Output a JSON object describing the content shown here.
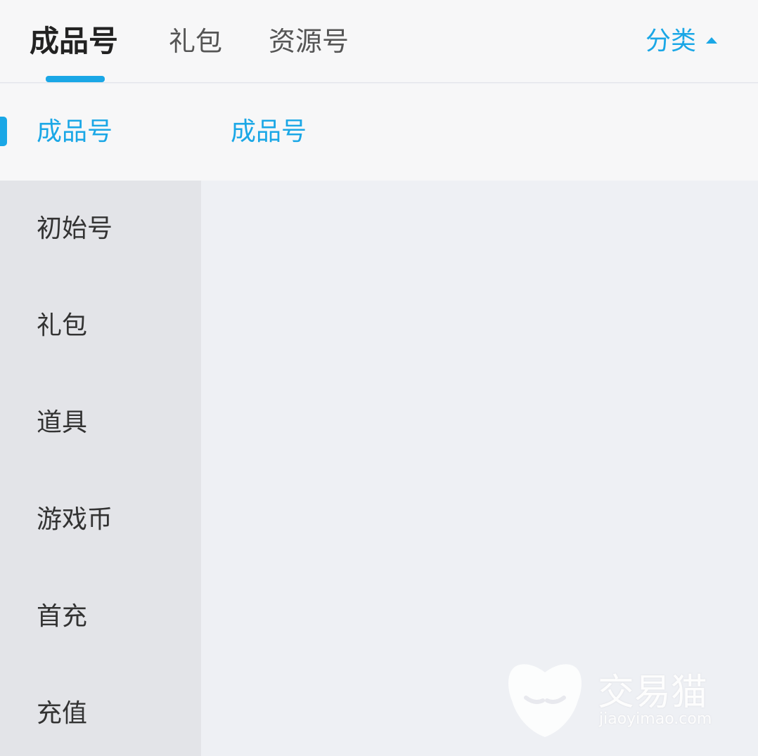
{
  "tabs": [
    {
      "label": "成品号",
      "active": true
    },
    {
      "label": "礼包",
      "active": false
    },
    {
      "label": "资源号",
      "active": false
    }
  ],
  "category_toggle": {
    "label": "分类",
    "icon": "caret-up-icon"
  },
  "sidebar": {
    "items": [
      {
        "label": "成品号",
        "active": true
      },
      {
        "label": "初始号",
        "active": false
      },
      {
        "label": "礼包",
        "active": false
      },
      {
        "label": "道具",
        "active": false
      },
      {
        "label": "游戏币",
        "active": false
      },
      {
        "label": "首充",
        "active": false
      },
      {
        "label": "充值",
        "active": false
      }
    ]
  },
  "content": {
    "title": "成品号"
  },
  "watermark": {
    "brand": "交易猫",
    "url": "jiaoyimao.com"
  },
  "colors": {
    "accent": "#1aa7e6",
    "sidebar_bg": "#e3e4e8",
    "surface": "#f7f7f8",
    "page_bg": "#eef0f4"
  }
}
